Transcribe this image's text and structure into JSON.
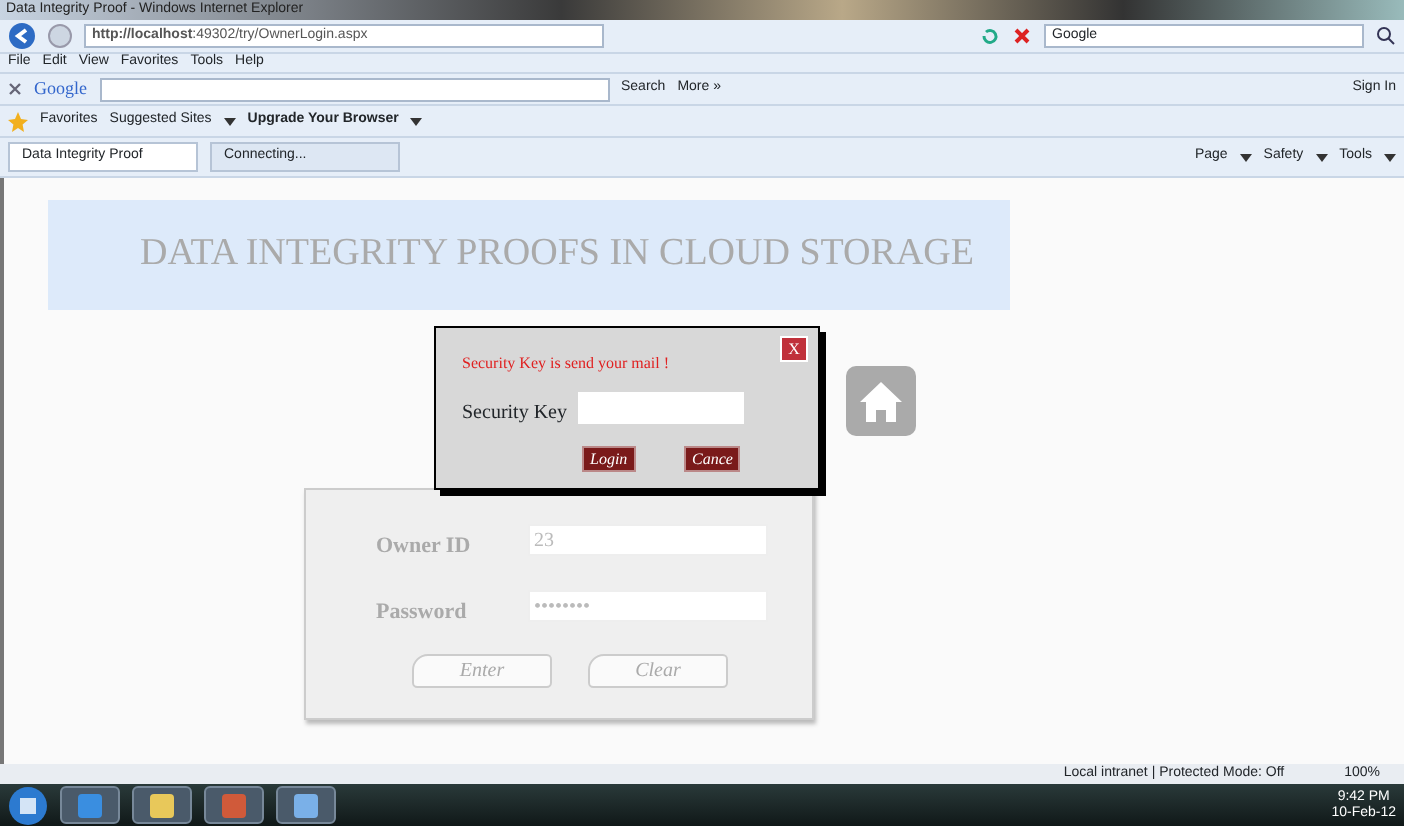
{
  "window": {
    "title": "Data Integrity Proof - Windows Internet Explorer"
  },
  "address_bar": {
    "url_host": "http://localhost",
    "url_rest": ":49302/try/OwnerLogin.aspx",
    "search_engine": "Google"
  },
  "menu": [
    "File",
    "Edit",
    "View",
    "Favorites",
    "Tools",
    "Help"
  ],
  "google_toolbar": {
    "logo": "Google",
    "search": "Search",
    "more": "More »",
    "sign_in": "Sign In"
  },
  "favorites_bar": {
    "favorites": "Favorites",
    "links": [
      {
        "label": "Suggested Sites",
        "bold": false
      },
      {
        "label": "Upgrade Your Browser",
        "bold": true
      }
    ]
  },
  "tabs": [
    {
      "label": "Data Integrity Proof",
      "selected": true
    },
    {
      "label": "Connecting...",
      "selected": false
    }
  ],
  "command_bar": [
    "Page",
    "Safety",
    "Tools"
  ],
  "page": {
    "heading": "DATA INTEGRITY PROOFS IN CLOUD STORAGE",
    "dialog": {
      "message": "Security Key is send your mail !",
      "close": "X",
      "field_label": "Security Key",
      "buttons": [
        "Login",
        "Cance"
      ]
    },
    "login": {
      "fields": [
        {
          "label": "Owner ID",
          "value": "23"
        },
        {
          "label": "Password",
          "value": "••••••••"
        }
      ],
      "buttons": [
        "Enter",
        "Clear"
      ]
    }
  },
  "status_bar": {
    "zone": "Local intranet | Protected Mode: Off",
    "zoom": "100%"
  },
  "taskbar": {
    "time": "9:42 PM",
    "date": "10-Feb-12"
  }
}
